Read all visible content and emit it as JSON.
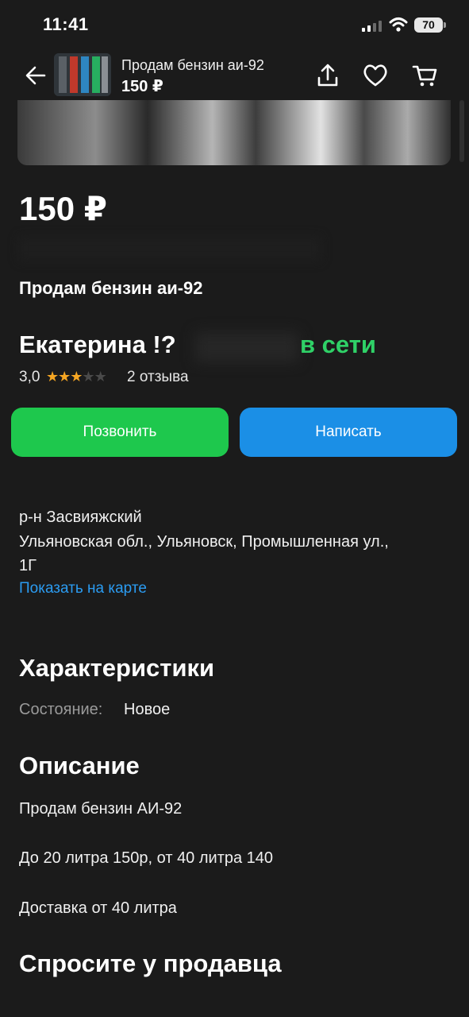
{
  "status": {
    "time": "11:41",
    "battery": "70"
  },
  "header": {
    "title": "Продам бензин аи-92",
    "price": "150 ₽"
  },
  "listing": {
    "price": "150 ₽",
    "title": "Продам бензин аи-92",
    "seller": {
      "name": "Екатерина !?",
      "online": "в сети",
      "rating": "3,0",
      "rating_value": 3,
      "rating_max": 5,
      "reviews": "2 отзыва"
    },
    "actions": {
      "call": "Позвонить",
      "write": "Написать"
    },
    "address": {
      "district": "р-н Засвияжский",
      "line1": "Ульяновская обл., Ульяновск, Промышленная ул.,",
      "line2": "1Г",
      "map_link": "Показать на карте"
    },
    "characteristics": {
      "heading": "Характеристики",
      "condition_label": "Состояние:",
      "condition_value": "Новое"
    },
    "description": {
      "heading": "Описание",
      "lines": [
        "Продам бензин АИ-92",
        "До 20 литра 150р, от 40 литра  140",
        "Доставка от 40 литра"
      ]
    },
    "ask_heading": "Спросите у продавца"
  },
  "colors": {
    "background": "#1b1b1b",
    "online": "#2fd167",
    "call_button": "#1ec84d",
    "write_button": "#1b8fe6",
    "link": "#2b9cf2",
    "star": "#f5a623"
  },
  "icons": [
    "signal-icon",
    "wifi-icon",
    "battery-icon",
    "back-arrow-icon",
    "share-icon",
    "heart-icon",
    "cart-icon",
    "star-icon"
  ]
}
